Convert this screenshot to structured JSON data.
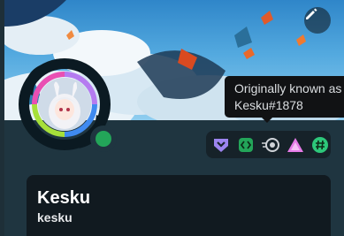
{
  "profile": {
    "display_name": "Kesku",
    "username": "kesku",
    "status": "online"
  },
  "tooltip": {
    "line1": "Originally known as",
    "line2": "Kesku#1878"
  },
  "badges": [
    {
      "icon": "hypesquad-icon"
    },
    {
      "icon": "active-developer-icon"
    },
    {
      "icon": "nitro-boost-icon"
    },
    {
      "icon": "triangle-badge-icon"
    },
    {
      "icon": "hashtag-badge-icon"
    }
  ],
  "colors": {
    "accent": "#23a559",
    "panel": "#1f3540",
    "card": "#111a20",
    "badge_bar": "#162229",
    "tooltip_bg": "#111214"
  }
}
